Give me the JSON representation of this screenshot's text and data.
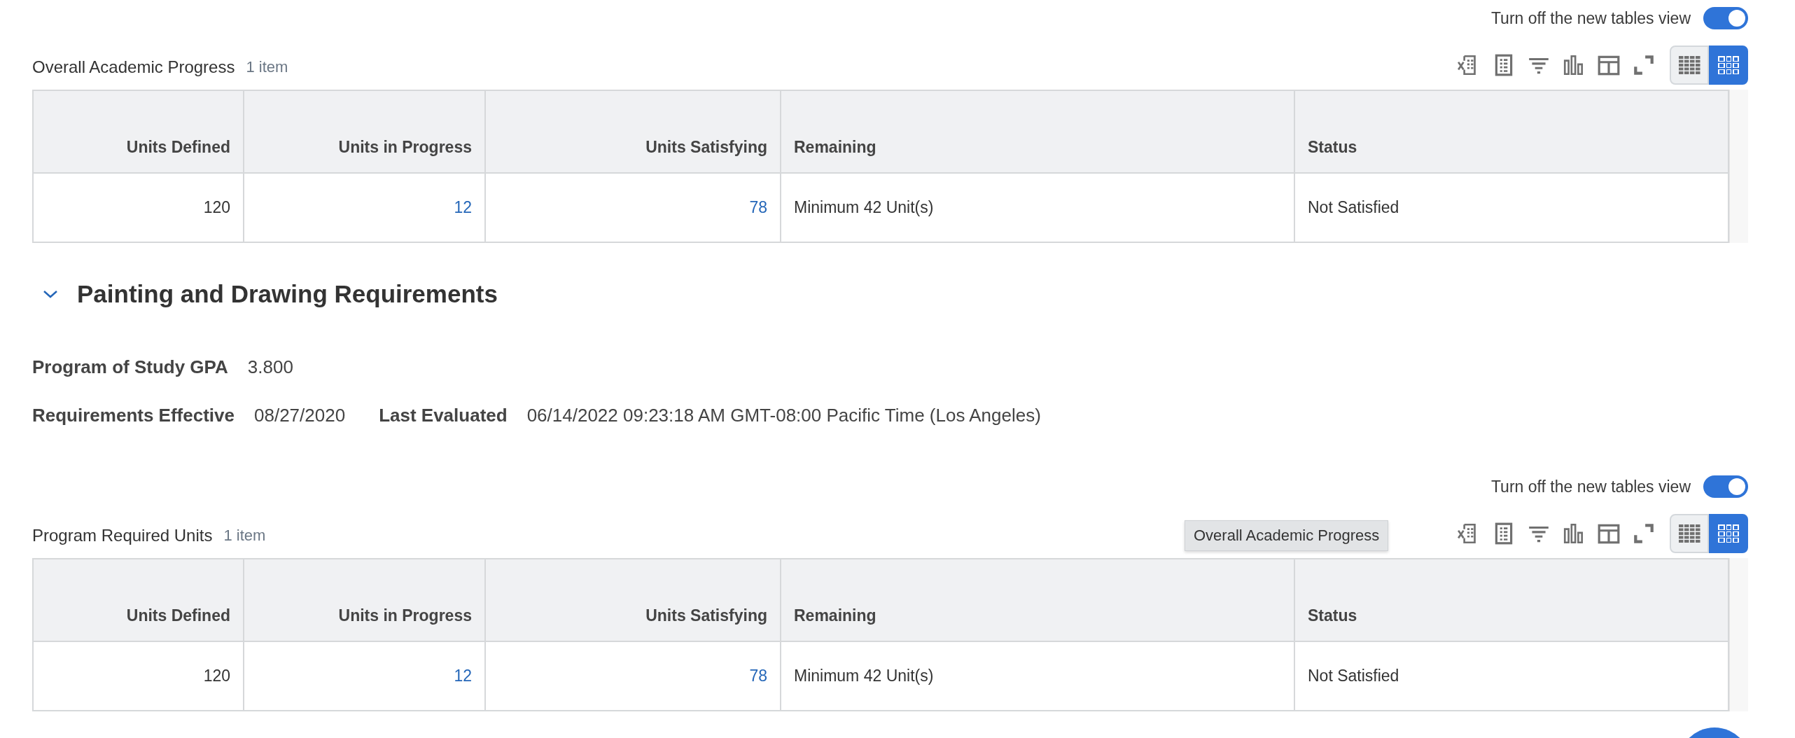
{
  "blocks": [
    {
      "kind": "table",
      "toggle": {
        "label": "Turn off the new tables view",
        "on": true
      },
      "title": "Overall Academic Progress",
      "count": "1 item",
      "view_modes": [
        {
          "selected": false
        },
        {
          "selected": true
        }
      ],
      "columns": [
        {
          "label": "Units Defined",
          "numeric": true
        },
        {
          "label": "Units in Progress",
          "numeric": true
        },
        {
          "label": "Units Satisfying",
          "numeric": true
        },
        {
          "label": "Remaining",
          "numeric": false
        },
        {
          "label": "Status",
          "numeric": false
        }
      ],
      "rows": [
        [
          {
            "text": "120",
            "link": false
          },
          {
            "text": "12",
            "link": true
          },
          {
            "text": "78",
            "link": true
          },
          {
            "text": "Minimum 42 Unit(s)",
            "link": false
          },
          {
            "text": "Not Satisfied",
            "link": false
          }
        ]
      ]
    },
    {
      "kind": "section",
      "title": "Painting and Drawing Requirements",
      "expanded": true,
      "fields": [
        [
          {
            "label": "Program of Study GPA",
            "value": "3.800"
          }
        ],
        [
          {
            "label": "Requirements Effective",
            "value": "08/27/2020"
          },
          {
            "label": "Last Evaluated",
            "value": "06/14/2022 09:23:18 AM GMT-08:00 Pacific Time (Los Angeles)"
          }
        ]
      ]
    },
    {
      "kind": "table",
      "toggle": {
        "label": "Turn off the new tables view",
        "on": true
      },
      "title": "Program Required Units",
      "count": "1 item",
      "tooltip": "Overall Academic Progress",
      "view_modes": [
        {
          "selected": false
        },
        {
          "selected": true
        }
      ],
      "columns": [
        {
          "label": "Units Defined",
          "numeric": true
        },
        {
          "label": "Units in Progress",
          "numeric": true
        },
        {
          "label": "Units Satisfying",
          "numeric": true
        },
        {
          "label": "Remaining",
          "numeric": false
        },
        {
          "label": "Status",
          "numeric": false
        }
      ],
      "rows": [
        [
          {
            "text": "120",
            "link": false
          },
          {
            "text": "12",
            "link": true
          },
          {
            "text": "78",
            "link": true
          },
          {
            "text": "Minimum 42 Unit(s)",
            "link": false
          },
          {
            "text": "Not Satisfied",
            "link": false
          }
        ]
      ]
    }
  ]
}
